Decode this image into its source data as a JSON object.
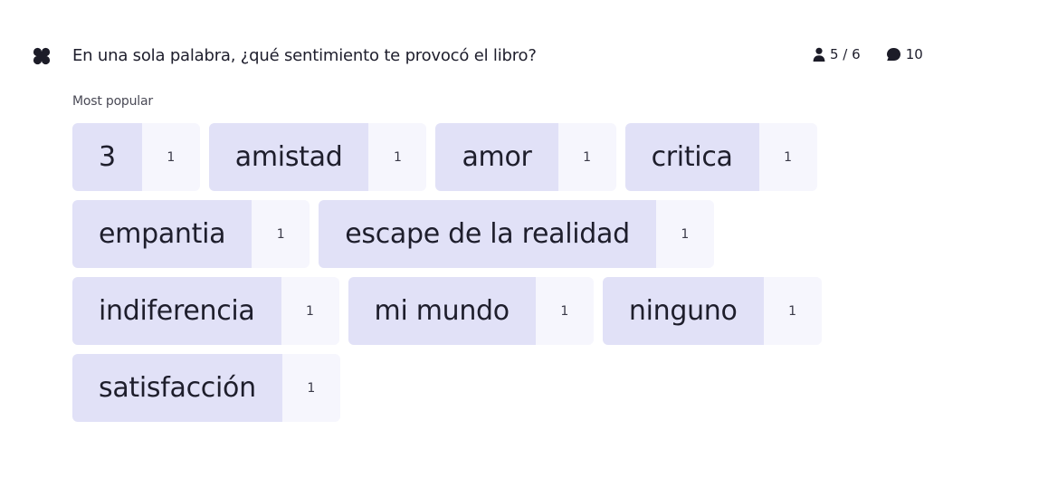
{
  "question": {
    "title": "En una sola palabra, ¿qué sentimiento te provocó el libro?",
    "brand_icon": "clover-icon"
  },
  "stats": {
    "participants": "5 / 6",
    "participants_icon": "person-icon",
    "responses": "10",
    "responses_icon": "comment-icon"
  },
  "section": {
    "label": "Most popular"
  },
  "words": [
    {
      "word": "3",
      "count": "1"
    },
    {
      "word": "amistad",
      "count": "1"
    },
    {
      "word": "amor",
      "count": "1"
    },
    {
      "word": "critica",
      "count": "1"
    },
    {
      "word": "empantia",
      "count": "1"
    },
    {
      "word": "escape de la realidad",
      "count": "1"
    },
    {
      "word": "indiferencia",
      "count": "1"
    },
    {
      "word": "mi mundo",
      "count": "1"
    },
    {
      "word": "ninguno",
      "count": "1"
    },
    {
      "word": "satisfacción",
      "count": "1"
    }
  ],
  "colors": {
    "chip_word_bg": "#e1e1f7",
    "chip_count_bg": "#f6f6fd",
    "text": "#1e1e2c"
  }
}
